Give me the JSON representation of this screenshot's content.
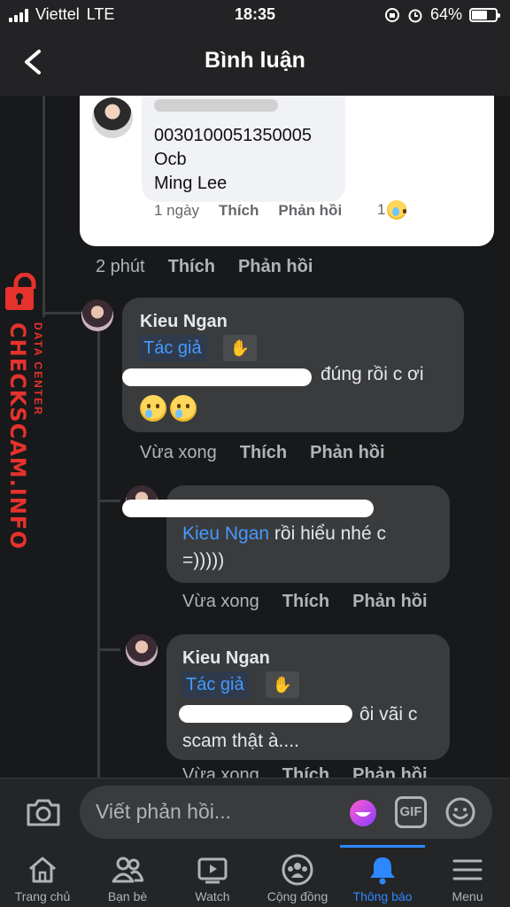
{
  "status_bar": {
    "carrier": "Viettel",
    "network": "LTE",
    "time": "18:35",
    "battery": "64%",
    "battery_level": 0.64
  },
  "header": {
    "title": "Bình luận",
    "back_icon": "chevron-left-icon"
  },
  "top_comment": {
    "lines": [
      "0030100051350005",
      "Ocb",
      "Ming Lee"
    ],
    "time": "1 ngày",
    "like": "Thích",
    "reply": "Phản hồi",
    "reaction_count": "1",
    "reaction_icon": "sad-face-icon"
  },
  "top_comment_meta": {
    "time": "2 phút",
    "like": "Thích",
    "reply": "Phản hồi"
  },
  "comments": [
    {
      "name": "Kieu Ngan",
      "badge": "Tác giả",
      "text": "đúng rồi c ơi",
      "time": "Vừa xong",
      "like": "Thích",
      "reply": "Phản hồi"
    },
    {
      "mention": "Kieu Ngan",
      "text_after_mention": " rồi hiểu nhé c",
      "text_line2": "=)))))",
      "time": "Vừa xong",
      "like": "Thích",
      "reply": "Phản hồi"
    },
    {
      "name": "Kieu Ngan",
      "badge": "Tác giả",
      "text": "ôi vãi c",
      "text_line2": "scam thật à....",
      "time": "Vừa xong",
      "like": "Thích",
      "reply": "Phản hồi"
    }
  ],
  "watermark": {
    "title": "CHECKSCAM.INFO",
    "subtitle": "DATA CENTER"
  },
  "composer": {
    "placeholder": "Viết phản hồi...",
    "gif_label": "GIF"
  },
  "tabs": [
    {
      "label": "Trang chủ",
      "icon": "home-icon"
    },
    {
      "label": "Bạn bè",
      "icon": "friends-icon"
    },
    {
      "label": "Watch",
      "icon": "watch-icon"
    },
    {
      "label": "Cộng đồng",
      "icon": "groups-icon"
    },
    {
      "label": "Thông báo",
      "icon": "bell-icon",
      "active": true
    },
    {
      "label": "Menu",
      "icon": "menu-icon"
    }
  ],
  "colors": {
    "accent": "#2d88ff",
    "link": "#4599ff",
    "watermark": "#e5322d"
  }
}
